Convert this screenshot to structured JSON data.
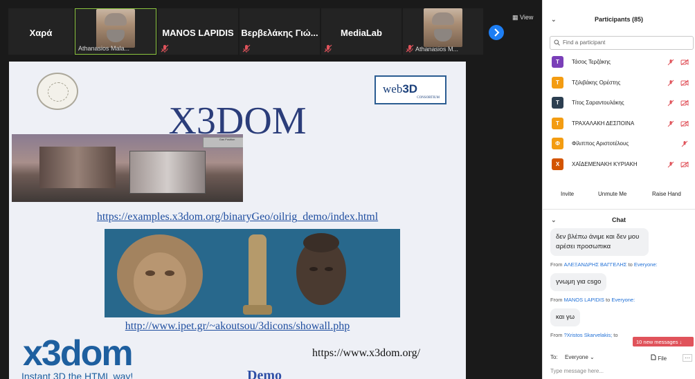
{
  "video_strip": {
    "tiles": [
      {
        "name": "Χαρά"
      },
      {
        "label": "Athanasios Mala..."
      },
      {
        "name": "MANOS LAPIDIS"
      },
      {
        "name": "Βερβελάκης Γιώ..."
      },
      {
        "name": "MediaLab"
      },
      {
        "label": "Athanasios M..."
      }
    ],
    "view_label": "View"
  },
  "slide": {
    "title": "X3DOM",
    "badge_web": "web",
    "badge_3d": "3D",
    "badge_consortium": "CONSORTIUM",
    "oilrig_panel_text": "Gas Position",
    "link1": "https://examples.x3dom.org/binaryGeo/oilrig_demo/index.html",
    "link2": "http://www.ipet.gr/~akoutsou/3dicons/showall.php",
    "logo_text": "x3dom",
    "logo_tagline": "Instant 3D the HTML way!",
    "url_text": "https://www.x3dom.org/",
    "demo_label": "Demo"
  },
  "participants": {
    "header": "Participants (85)",
    "search_placeholder": "Find a participant",
    "list": [
      {
        "initial": "T",
        "name": "Τάσος Τερζάκης",
        "color": "#7a3fb8"
      },
      {
        "initial": "T",
        "name": "Τζιλιβάκης Ορέστης",
        "color": "#f39c12"
      },
      {
        "initial": "T",
        "name": "Τίτος Σαραντουλάκης",
        "color": "#2c3e50"
      },
      {
        "initial": "T",
        "name": "ΤΡΑΧΑΛΑΚΗ ΔΕΣΠΟΙΝΑ",
        "color": "#f39c12"
      },
      {
        "initial": "Φ",
        "name": "Φίλιππος Αριστοτέλους",
        "color": "#f39c12"
      },
      {
        "initial": "X",
        "name": "ΧΑΪΔΕΜΕΝΑΚΗ ΚΥΡΙΑΚΗ",
        "color": "#d35400"
      }
    ],
    "invite_label": "Invite",
    "unmute_label": "Unmute Me",
    "raise_hand_label": "Raise Hand"
  },
  "chat": {
    "header": "Chat",
    "messages": [
      {
        "text": "δεν βλέπω άνιμε και δεν μου αρέσει προσωπικα"
      },
      {
        "from": "From",
        "sender": "ΑΛΕΞΑΝΔΡΗΣ ΒΑΓΓΕΛΗΣ",
        "to": "to",
        "recipient": "Everyone:"
      },
      {
        "text": "γνωμη για csgo"
      },
      {
        "from": "From",
        "sender": "MANOS LAPIDIS",
        "to": "to",
        "recipient": "Everyone:"
      },
      {
        "text": "και γω"
      },
      {
        "from": "From",
        "sender": "?Xristos Skarvelakis;",
        "to": "to"
      }
    ],
    "new_messages": "10 new messages ↓",
    "to_label": "To:",
    "to_value": "Everyone",
    "file_label": "File",
    "more_label": "···",
    "type_placeholder": "Type message here..."
  },
  "colors": {
    "accent_blue": "#1d7ef4",
    "muted_red": "#e0535b",
    "link_blue": "#1f6fd6"
  }
}
